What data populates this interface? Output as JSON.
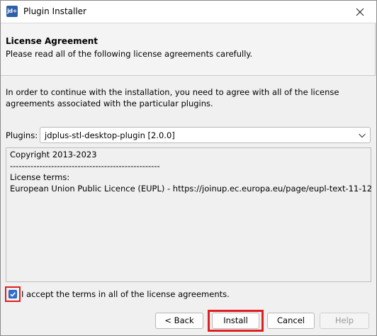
{
  "window": {
    "title": "Plugin Installer",
    "app_icon_text": "jd+"
  },
  "header": {
    "title": "License Agreement",
    "subtitle": "Please read all of the following license agreements carefully."
  },
  "intro_text": "In order to continue with the installation, you need to agree with all of the license agreements associated with the particular plugins.",
  "plugins": {
    "label": "Plugins:",
    "selected": "jdplus-stl-desktop-plugin [2.0.0]"
  },
  "license": {
    "lines": [
      "Copyright  2013-2023",
      "---------------------------------------------------",
      "License terms:",
      "European Union Public Licence (EUPL) - https://joinup.ec.europa.eu/page/eupl-text-11-12"
    ]
  },
  "accept": {
    "checked": true,
    "label": "I accept the terms in all of the license agreements."
  },
  "buttons": {
    "back": "< Back",
    "install": "Install",
    "cancel": "Cancel",
    "help": "Help"
  },
  "colors": {
    "highlight": "#e02020",
    "checkbox": "#2f6fd6"
  }
}
